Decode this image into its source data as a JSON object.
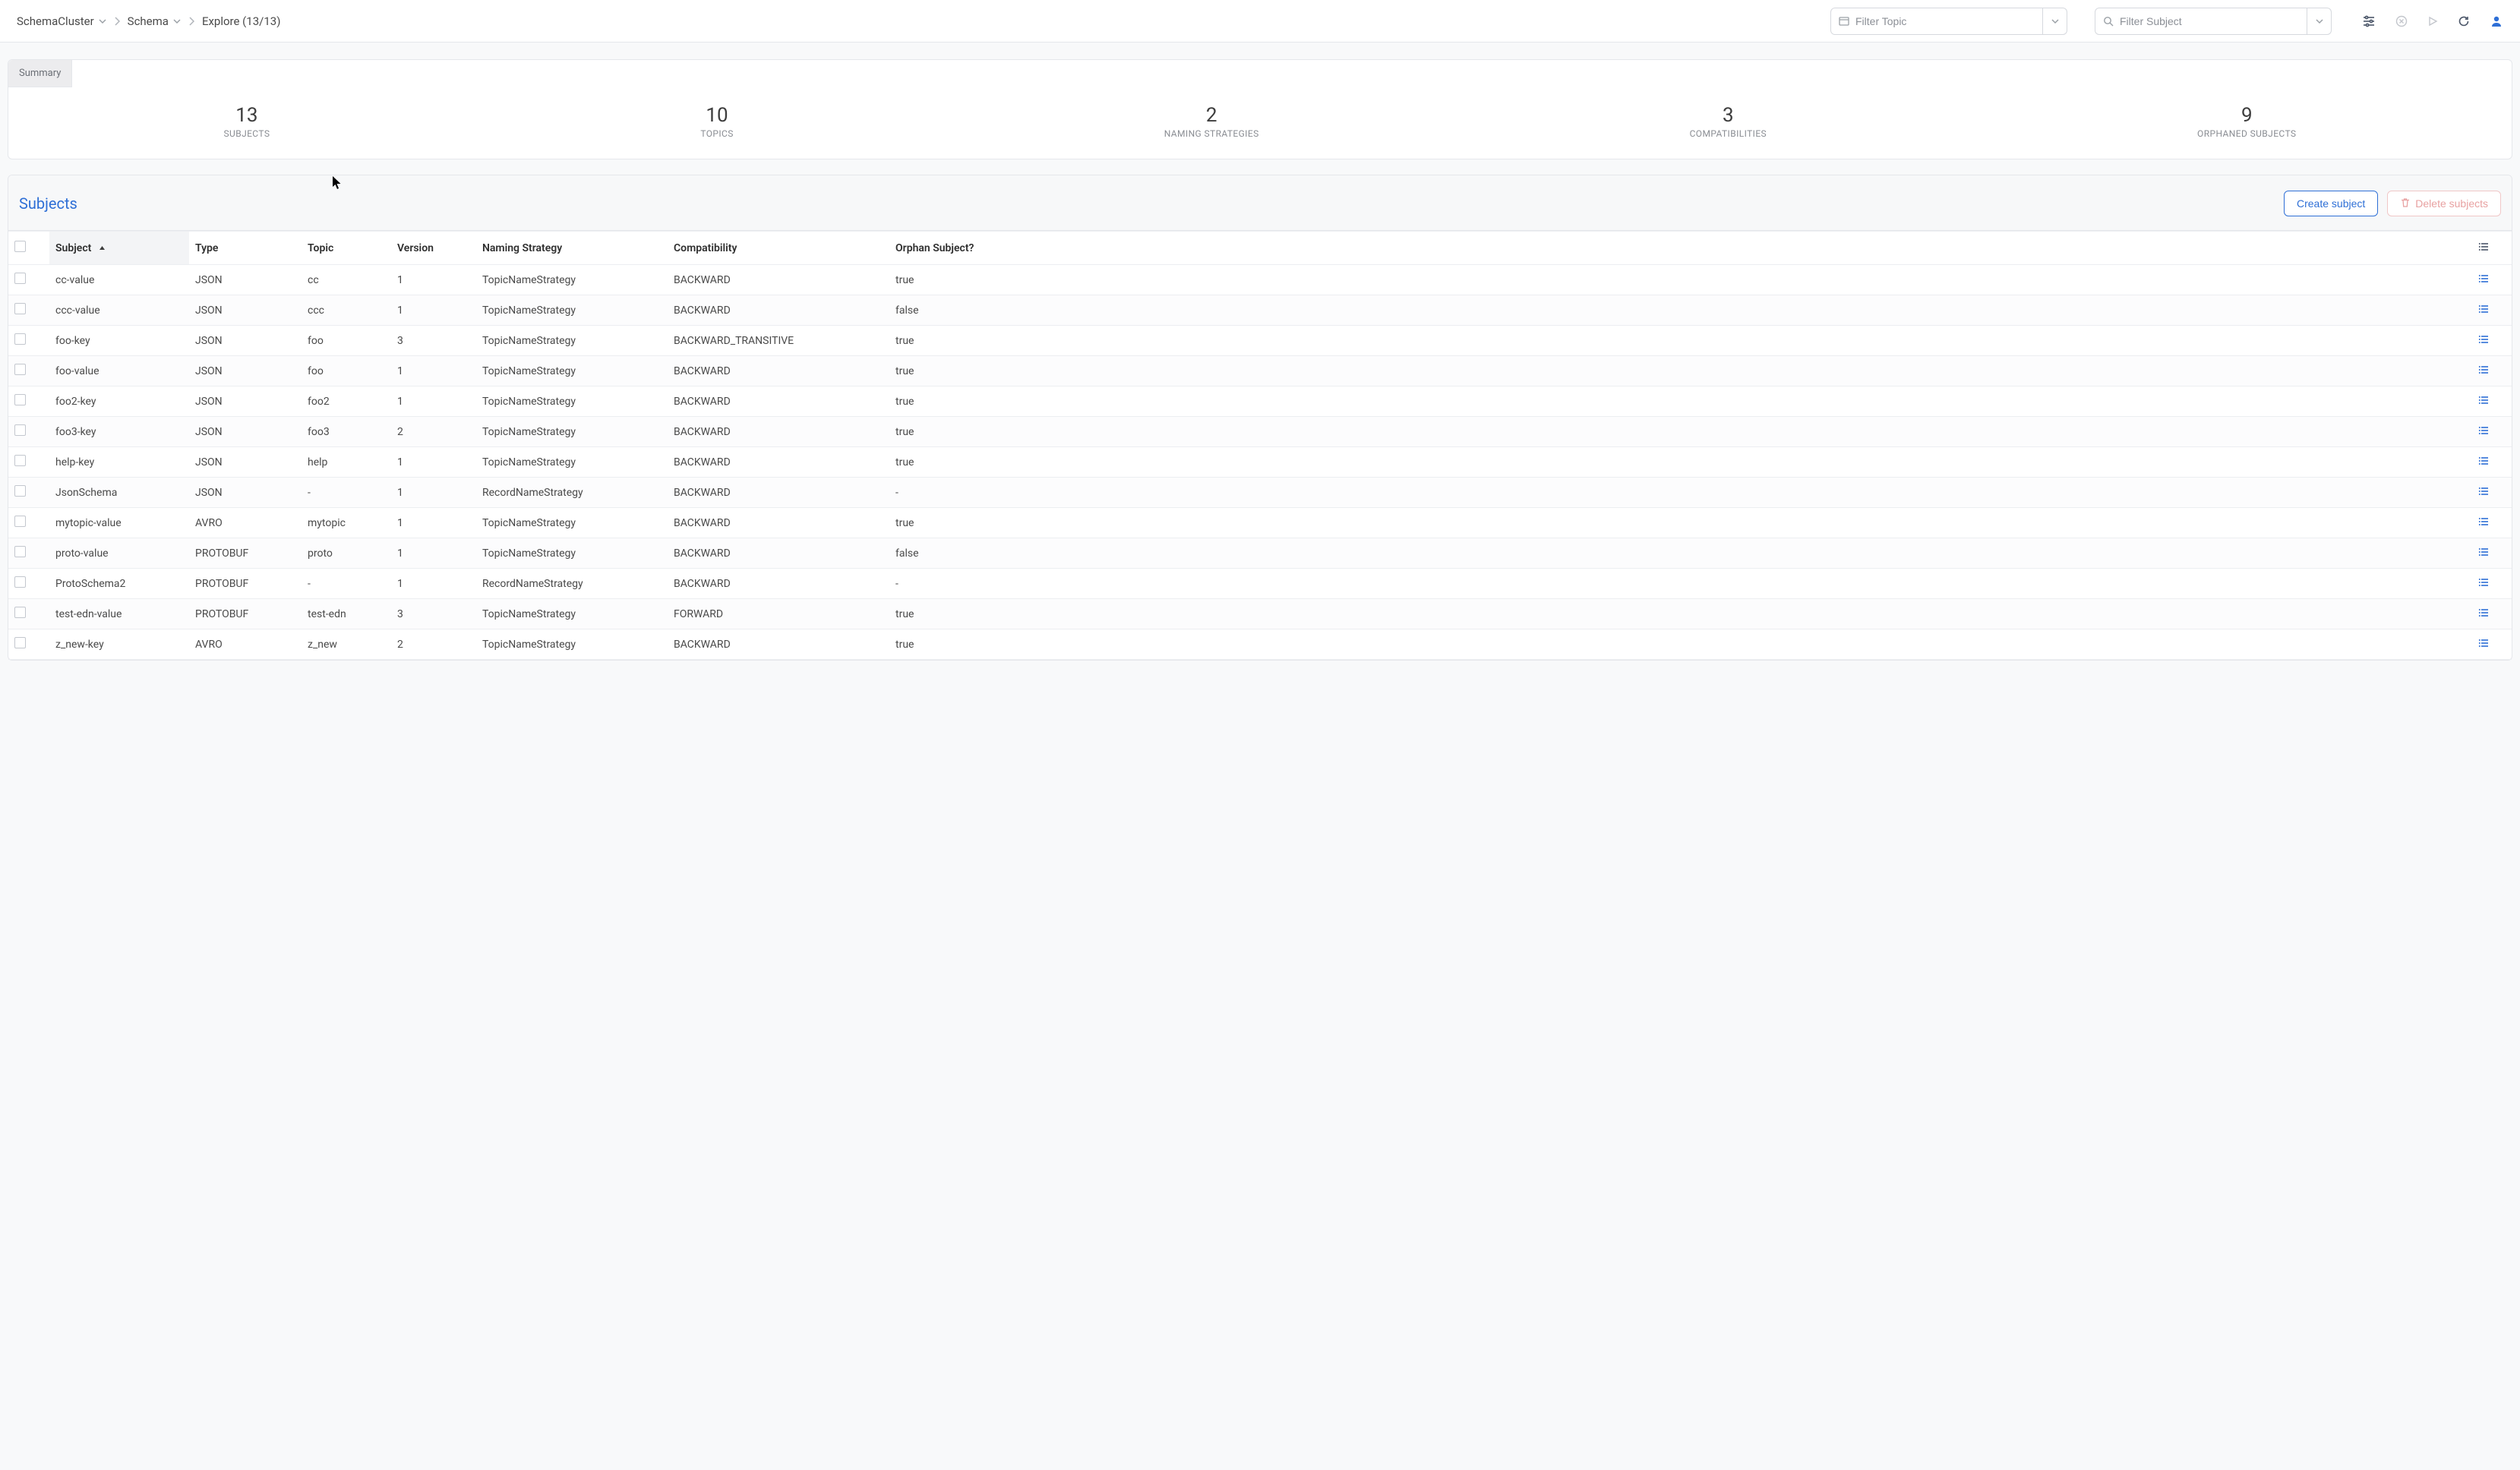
{
  "breadcrumbs": {
    "cluster": "SchemaCluster",
    "schema": "Schema",
    "explore": "Explore (13/13)"
  },
  "filters": {
    "topic_placeholder": "Filter Topic",
    "subject_placeholder": "Filter Subject"
  },
  "summary": {
    "tab_label": "Summary",
    "stats": [
      {
        "value": "13",
        "label": "SUBJECTS"
      },
      {
        "value": "10",
        "label": "TOPICS"
      },
      {
        "value": "2",
        "label": "NAMING STRATEGIES"
      },
      {
        "value": "3",
        "label": "COMPATIBILITIES"
      },
      {
        "value": "9",
        "label": "ORPHANED SUBJECTS"
      }
    ]
  },
  "subjects": {
    "title": "Subjects",
    "create_label": "Create subject",
    "delete_label": "Delete subjects",
    "columns": {
      "subject": "Subject",
      "type": "Type",
      "topic": "Topic",
      "version": "Version",
      "naming": "Naming Strategy",
      "compat": "Compatibility",
      "orphan": "Orphan Subject?"
    },
    "rows": [
      {
        "subject": "cc-value",
        "type": "JSON",
        "topic": "cc",
        "version": "1",
        "naming": "TopicNameStrategy",
        "compat": "BACKWARD",
        "orphan": "true"
      },
      {
        "subject": "ccc-value",
        "type": "JSON",
        "topic": "ccc",
        "version": "1",
        "naming": "TopicNameStrategy",
        "compat": "BACKWARD",
        "orphan": "false"
      },
      {
        "subject": "foo-key",
        "type": "JSON",
        "topic": "foo",
        "version": "3",
        "naming": "TopicNameStrategy",
        "compat": "BACKWARD_TRANSITIVE",
        "orphan": "true"
      },
      {
        "subject": "foo-value",
        "type": "JSON",
        "topic": "foo",
        "version": "1",
        "naming": "TopicNameStrategy",
        "compat": "BACKWARD",
        "orphan": "true"
      },
      {
        "subject": "foo2-key",
        "type": "JSON",
        "topic": "foo2",
        "version": "1",
        "naming": "TopicNameStrategy",
        "compat": "BACKWARD",
        "orphan": "true"
      },
      {
        "subject": "foo3-key",
        "type": "JSON",
        "topic": "foo3",
        "version": "2",
        "naming": "TopicNameStrategy",
        "compat": "BACKWARD",
        "orphan": "true"
      },
      {
        "subject": "help-key",
        "type": "JSON",
        "topic": "help",
        "version": "1",
        "naming": "TopicNameStrategy",
        "compat": "BACKWARD",
        "orphan": "true"
      },
      {
        "subject": "JsonSchema",
        "type": "JSON",
        "topic": "-",
        "version": "1",
        "naming": "RecordNameStrategy",
        "compat": "BACKWARD",
        "orphan": "-"
      },
      {
        "subject": "mytopic-value",
        "type": "AVRO",
        "topic": "mytopic",
        "version": "1",
        "naming": "TopicNameStrategy",
        "compat": "BACKWARD",
        "orphan": "true"
      },
      {
        "subject": "proto-value",
        "type": "PROTOBUF",
        "topic": "proto",
        "version": "1",
        "naming": "TopicNameStrategy",
        "compat": "BACKWARD",
        "orphan": "false"
      },
      {
        "subject": "ProtoSchema2",
        "type": "PROTOBUF",
        "topic": "-",
        "version": "1",
        "naming": "RecordNameStrategy",
        "compat": "BACKWARD",
        "orphan": "-"
      },
      {
        "subject": "test-edn-value",
        "type": "PROTOBUF",
        "topic": "test-edn",
        "version": "3",
        "naming": "TopicNameStrategy",
        "compat": "FORWARD",
        "orphan": "true"
      },
      {
        "subject": "z_new-key",
        "type": "AVRO",
        "topic": "z_new",
        "version": "2",
        "naming": "TopicNameStrategy",
        "compat": "BACKWARD",
        "orphan": "true"
      }
    ]
  }
}
